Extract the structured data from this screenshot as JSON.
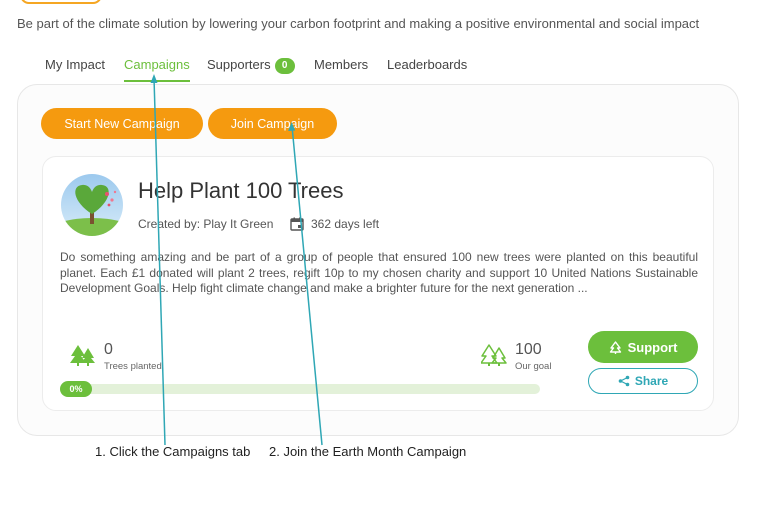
{
  "tagline": "Be part of the climate solution by lowering your carbon footprint and making a positive environmental and social impact",
  "tabs": [
    {
      "label": "My Impact"
    },
    {
      "label": "Campaigns",
      "active": true
    },
    {
      "label": "Supporters",
      "badge": "0"
    },
    {
      "label": "Members"
    },
    {
      "label": "Leaderboards"
    }
  ],
  "actions": {
    "start_label": "Start New Campaign",
    "join_label": "Join Campaign"
  },
  "campaign": {
    "title": "Help Plant 100 Trees",
    "created_by": "Created by: Play It Green",
    "days_left": "362 days left",
    "description": "Do something amazing and be part of a group of people that ensured 100 new trees were planted on this beautiful planet. Each £1 donated will plant 2 trees, regift 10p to my chosen charity and support 10 United Nations Sustainable Development Goals. Help fight climate change and make a brighter future for the next generation ...",
    "trees_planted_value": "0",
    "trees_planted_label": "Trees planted",
    "goal_value": "100",
    "goal_label": "Our goal",
    "progress_label": "0%",
    "progress_fraction": 0,
    "support_label": "Support",
    "share_label": "Share"
  },
  "annotations": {
    "step1": "1. Click the Campaigns tab",
    "step2": "2. Join the Earth Month Campaign"
  },
  "icons": {
    "trees": "trees-icon",
    "calendar": "calendar-icon",
    "support": "tree-icon",
    "share": "share-icon"
  },
  "colors": {
    "accent_green": "#6cbf3c",
    "accent_orange": "#f59a0f",
    "share_teal": "#2fa7b5",
    "annotation_line": "#2fa7b5"
  }
}
